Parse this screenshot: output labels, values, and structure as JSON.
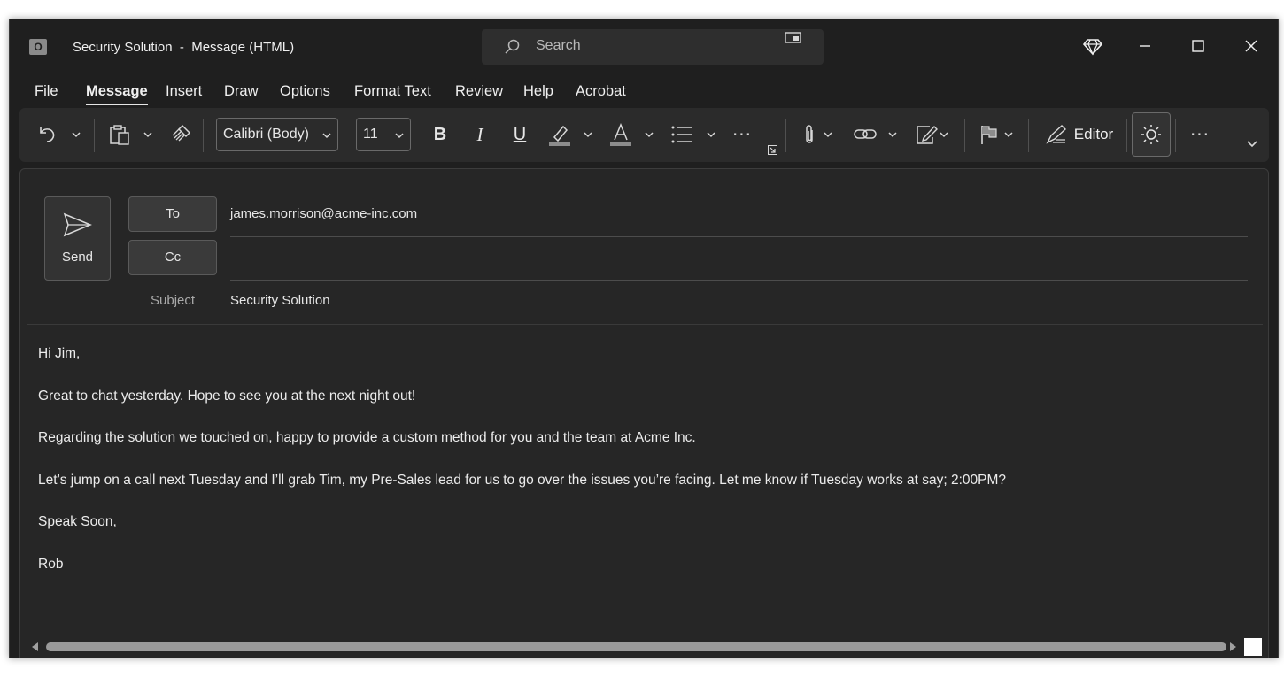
{
  "window": {
    "app_icon_letter": "O",
    "title": "Security Solution  -  Message (HTML)",
    "search_placeholder": "Search"
  },
  "tabs": [
    {
      "label": "File"
    },
    {
      "label": "Message",
      "active": true
    },
    {
      "label": "Insert"
    },
    {
      "label": "Draw"
    },
    {
      "label": "Options"
    },
    {
      "label": "Format Text"
    },
    {
      "label": "Review"
    },
    {
      "label": "Help"
    },
    {
      "label": "Acrobat"
    }
  ],
  "ribbon": {
    "font_name": "Calibri (Body)",
    "font_size": "11",
    "bold_glyph": "B",
    "italic_glyph": "I",
    "underline_glyph": "U",
    "editor_label": "Editor",
    "more_glyph": "···",
    "highlight_color": "#8c8c8c",
    "font_color": "#8c8c8c"
  },
  "compose": {
    "send_label": "Send",
    "to_label": "To",
    "cc_label": "Cc",
    "to_value": "james.morrison@acme-inc.com",
    "cc_value": "",
    "subject_label": "Subject",
    "subject_value": "Security Solution"
  },
  "body": {
    "lines": [
      "Hi Jim,",
      "Great to chat yesterday. Hope to see you at the next night out!",
      "Regarding the solution we touched on, happy to provide a custom method for you and the team at Acme Inc.",
      "Let’s jump on a call next Tuesday and I’ll grab Tim, my Pre-Sales lead for us to go over the issues you’re facing. Let me know if Tuesday works at say; 2:00PM?",
      "Speak Soon,",
      "Rob"
    ]
  }
}
